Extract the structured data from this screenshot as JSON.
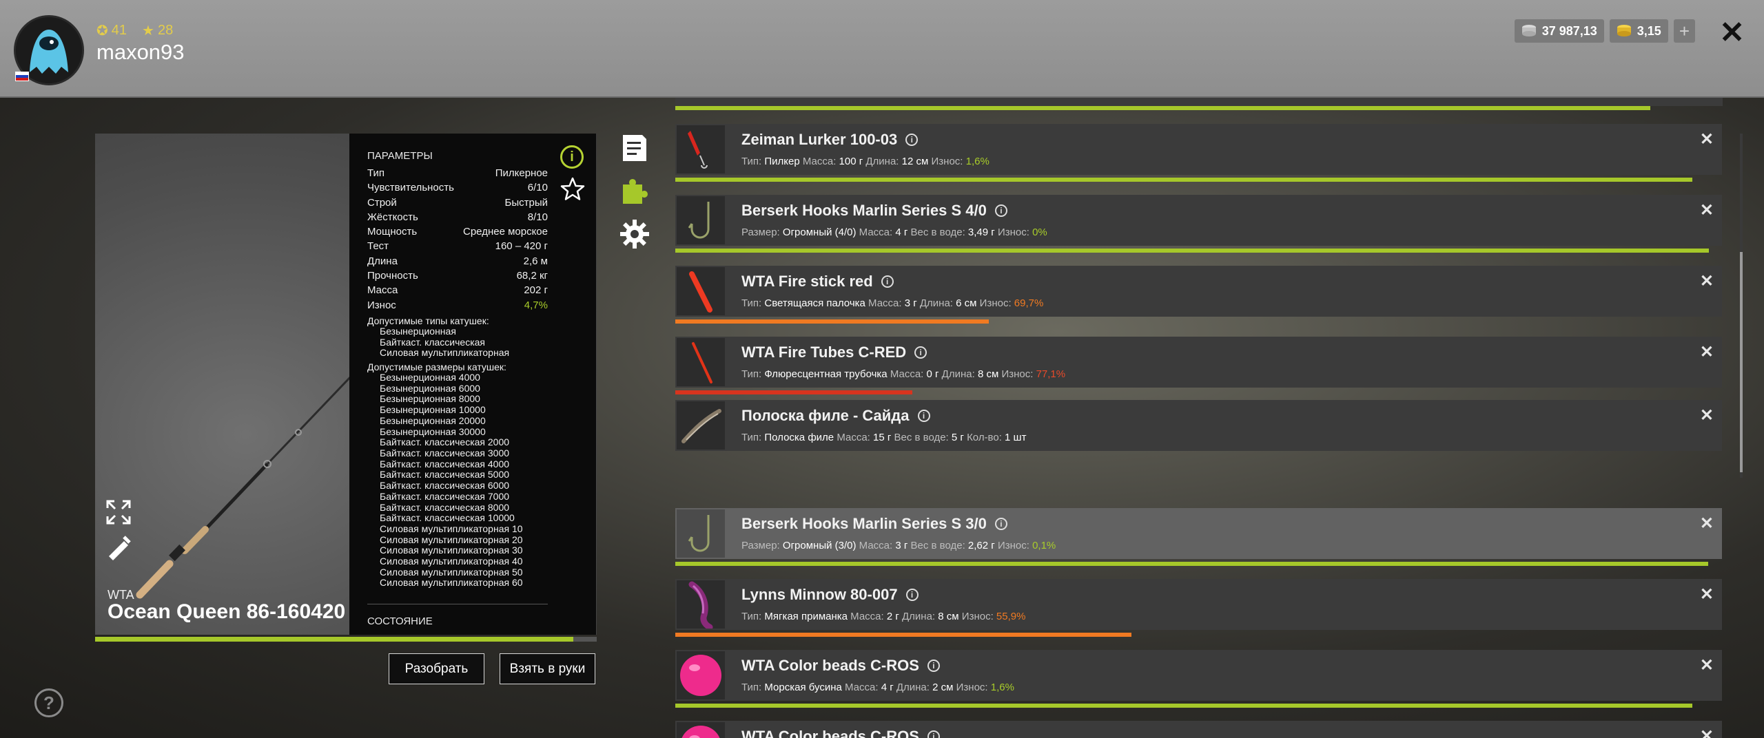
{
  "header": {
    "level": "41",
    "rating": "28",
    "username": "maxon93",
    "silver": "37 987,13",
    "gold": "3,15",
    "plus": "+",
    "close": "✕"
  },
  "item": {
    "brand": "WTA",
    "name": "Ocean Queen 86-160420",
    "wear_fraction": 0.953,
    "params_title": "ПАРАМЕТРЫ",
    "params": [
      {
        "label": "Тип",
        "value": "Пилкерное"
      },
      {
        "label": "Чувствительность",
        "value": "6/10"
      },
      {
        "label": "Строй",
        "value": "Быстрый"
      },
      {
        "label": "Жёсткость",
        "value": "8/10"
      },
      {
        "label": "Мощность",
        "value": "Среднее морское"
      },
      {
        "label": "Тест",
        "value": "160 – 420 г"
      },
      {
        "label": "Длина",
        "value": "2,6 м"
      },
      {
        "label": "Прочность",
        "value": "68,2 кг"
      },
      {
        "label": "Масса",
        "value": "202 г"
      },
      {
        "label": "Износ",
        "value": "4,7%"
      }
    ],
    "reel_types_title": "Допустимые типы катушек:",
    "reel_types": [
      "Безынерционная",
      "Байткаст. классическая",
      "Силовая мультипликаторная"
    ],
    "reel_sizes_title": "Допустимые размеры катушек:",
    "reel_sizes": [
      "Безынерционная 4000",
      "Безынерционная 6000",
      "Безынерционная 8000",
      "Безынерционная 10000",
      "Безынерционная 20000",
      "Безынерционная 30000",
      "Байткаст. классическая 2000",
      "Байткаст. классическая 3000",
      "Байткаст. классическая 4000",
      "Байткаст. классическая 5000",
      "Байткаст. классическая 6000",
      "Байткаст. классическая 7000",
      "Байткаст. классическая 8000",
      "Байткаст. классическая 10000",
      "Силовая мультипликаторная 10",
      "Силовая мультипликаторная 20",
      "Силовая мультипликаторная 30",
      "Силовая мультипликаторная 40",
      "Силовая мультипликаторная 50",
      "Силовая мультипликаторная 60"
    ],
    "state_title": "СОСТОЯНИЕ"
  },
  "buttons": {
    "disassemble": "Разобрать",
    "take": "Взять в руки"
  },
  "help": "?",
  "list": [
    {
      "name": "Zeiman Lurker 100-03",
      "thumb": "red-jig",
      "desc": [
        [
          "Тип:",
          "Пилкер"
        ],
        [
          "Масса:",
          "100 г"
        ],
        [
          "Длина:",
          "12 см"
        ]
      ],
      "wear_label": "Износ:",
      "wear": "1,6%",
      "wear_color": "g",
      "bar": 0.984,
      "light": false
    },
    {
      "name": "Berserk Hooks Marlin Series S 4/0",
      "thumb": "hook",
      "desc": [
        [
          "Размер:",
          "Огромный (4/0)"
        ],
        [
          "Масса:",
          "4 г"
        ],
        [
          "Вес в воде:",
          "3,49 г"
        ]
      ],
      "wear_label": "Износ:",
      "wear": "0%",
      "wear_color": "g",
      "bar": 1.0,
      "light": false
    },
    {
      "name": "WTA Fire stick red",
      "thumb": "red-stick",
      "desc": [
        [
          "Тип:",
          "Светящаяся палочка"
        ],
        [
          "Масса:",
          "3 г"
        ],
        [
          "Длина:",
          "6 см"
        ]
      ],
      "wear_label": "Износ:",
      "wear": "69,7%",
      "wear_color": "o",
      "bar": 0.303,
      "light": false
    },
    {
      "name": "WTA Fire Tubes C-RED",
      "thumb": "red-tube",
      "desc": [
        [
          "Тип:",
          "Флюресцентная трубочка"
        ],
        [
          "Масса:",
          "0 г"
        ],
        [
          "Длина:",
          "8 см"
        ]
      ],
      "wear_label": "Износ:",
      "wear": "77,1%",
      "wear_color": "r",
      "bar": 0.229,
      "light": false
    },
    {
      "name": "Полоска филе - Сайда",
      "thumb": "fillet",
      "desc": [
        [
          "Тип:",
          "Полоска филе"
        ],
        [
          "Масса:",
          "15 г"
        ],
        [
          "Вес в воде:",
          "5 г"
        ],
        [
          "Кол-во:",
          "1 шт"
        ]
      ],
      "wear_label": "",
      "wear": "",
      "wear_color": "",
      "bar": 0,
      "light": false
    },
    {
      "name": "Berserk Hooks Marlin Series S 3/0",
      "thumb": "hook",
      "desc": [
        [
          "Размер:",
          "Огромный (3/0)"
        ],
        [
          "Масса:",
          "3 г"
        ],
        [
          "Вес в воде:",
          "2,62 г"
        ]
      ],
      "wear_label": "Износ:",
      "wear": "0,1%",
      "wear_color": "g",
      "bar": 0.999,
      "light": true
    },
    {
      "name": "Lynns Minnow 80-007",
      "thumb": "soft-bait",
      "desc": [
        [
          "Тип:",
          "Мягкая приманка"
        ],
        [
          "Масса:",
          "2 г"
        ],
        [
          "Длина:",
          "8 см"
        ]
      ],
      "wear_label": "Износ:",
      "wear": "55,9%",
      "wear_color": "o",
      "bar": 0.441,
      "light": false
    },
    {
      "name": "WTA Color beads C-ROS",
      "thumb": "pink-bead",
      "desc": [
        [
          "Тип:",
          "Морская бусина"
        ],
        [
          "Масса:",
          "4 г"
        ],
        [
          "Длина:",
          "2 см"
        ]
      ],
      "wear_label": "Износ:",
      "wear": "1,6%",
      "wear_color": "g",
      "bar": 0.984,
      "light": false
    },
    {
      "name": "WTA Color beads C-ROS",
      "thumb": "pink-bead",
      "desc": [],
      "wear_label": "",
      "wear": "",
      "wear_color": "",
      "bar": 0,
      "light": false
    }
  ]
}
